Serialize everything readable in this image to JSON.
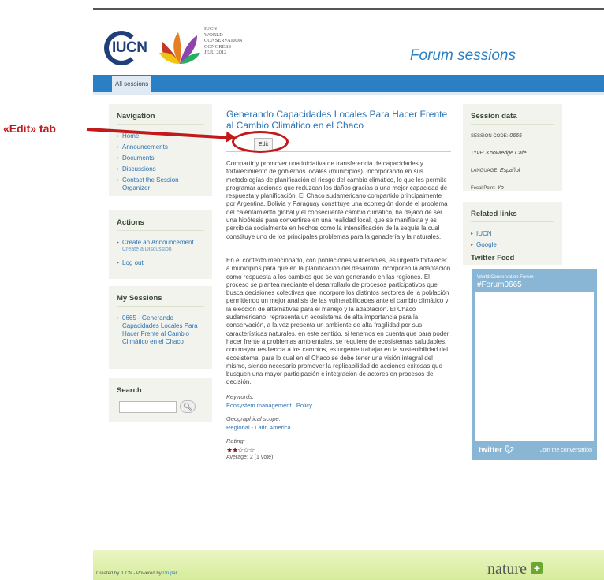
{
  "header": {
    "iucn_logo_text": "IUCN",
    "wcc_line1": "IUCN",
    "wcc_line2": "World",
    "wcc_line3": "Conservation",
    "wcc_line4": "Congress",
    "wcc_line5": "Jeju 2012",
    "forum_title": "Forum sessions"
  },
  "nav_tab": "All sessions",
  "sidebar_left": {
    "navigation": {
      "title": "Navigation",
      "items": [
        "Home",
        "Announcements",
        "Documents",
        "Discussions",
        "Contact the Session Organizer"
      ]
    },
    "actions": {
      "title": "Actions",
      "items": [
        "Create an Announcement",
        "Create a Discussion",
        "Log out"
      ]
    },
    "my_sessions": {
      "title": "My Sessions",
      "items": [
        "0665 - Generando Capacidades Locales Para Hacer Frente al Cambio Climático en el Chaco"
      ]
    },
    "search": {
      "title": "Search",
      "placeholder": ""
    }
  },
  "main": {
    "title": "Generando Capacidades Locales Para Hacer Frente al Cambio Climático en el Chaco",
    "edit_tab": "Edit",
    "paragraph1": "Compartir y promover una iniciativa de transferencia de capacidades y fortalecimiento de gobiernos locales (municipios), incorporando en sus metodologías de planificación el riesgo del cambio climático, lo que les permite programar acciones que reduzcan los daños gracias a una mejor capacidad de respuesta y planificación. El Chaco sudamericano compartido principalmente por Argentina, Bolivia y Paraguay constituye una ecorregión donde el problema del calentamiento global y el consecuente cambio climático, ha dejado de ser una hipótesis para convertirse en una realidad local, que se manifiesta y es percibida socialmente en hechos como la intensificación de la sequía la cual constituye uno de los principales problemas para la ganadería y la naturales.",
    "paragraph2": "En el contexto mencionado, con poblaciones vulnerables, es urgente fortalecer a municipios para que en la planificación del desarrollo incorporen la adaptación como respuesta a los cambios que se van generando en las regiones. El proceso se plantea mediante el desarrollarlo de procesos participativos que busca decisiones colectivas que incorpore los distintos sectores de la población permitiendo un mejor análisis de las vulnerabilidades ante el cambio climático y la elección de alternativas para el manejo y la adaptación. El Chaco sudamericano, representa un ecosistema de alta importancia para la conservación, a la vez presenta un ambiente de alta fragilidad por sus características naturales, en este sentido, si tenemos en cuenta que para poder hacer frente a problemas ambientales, se requiere de ecosistemas saludables, con mayor resiliencia a los cambios, es urgente trabajar en la sostenibilidad del ecosistema, para lo cual en el Chaco se debe tener una visión integral del mismo, siendo necesario promover la replicabilidad de acciones exitosas que busquen una mayor participación e integración de actores en procesos de decisión.",
    "keywords_label": "Keywords:",
    "keywords": [
      "Ecosystem management",
      "Policy"
    ],
    "geo_label": "Geographical scope:",
    "geo_value": "Regional - Latin America",
    "rating_label": "Rating:",
    "rating_value": 2,
    "rating_max": 5,
    "rating_avg": "Average: 2 (1 vote)"
  },
  "sidebar_right": {
    "session_data": {
      "title": "Session data",
      "code_label": "Session code:",
      "code_value": "0665",
      "type_label": "Type:",
      "type_value": "Knowledge Cafe",
      "lang_label": "Language:",
      "lang_value": "Español",
      "focal_label": "Focal Point:",
      "focal_value": "Yo"
    },
    "related_links": {
      "title": "Related links",
      "items": [
        "IUCN",
        "Google"
      ]
    },
    "twitter_feed_title": "Twitter Feed",
    "twitter": {
      "forum_name": "World Conservation Forum",
      "hashtag": "#Forum0665",
      "brand": "twitter",
      "join": "Join the conversation"
    }
  },
  "footer": {
    "created_by": "Created by",
    "iucn": "IUCN",
    "powered_by": "- Powered by",
    "drupal": "Drupal",
    "nature": "nature"
  },
  "annotation": {
    "label": "«Edit» tab",
    "color": "#c21a1a"
  }
}
